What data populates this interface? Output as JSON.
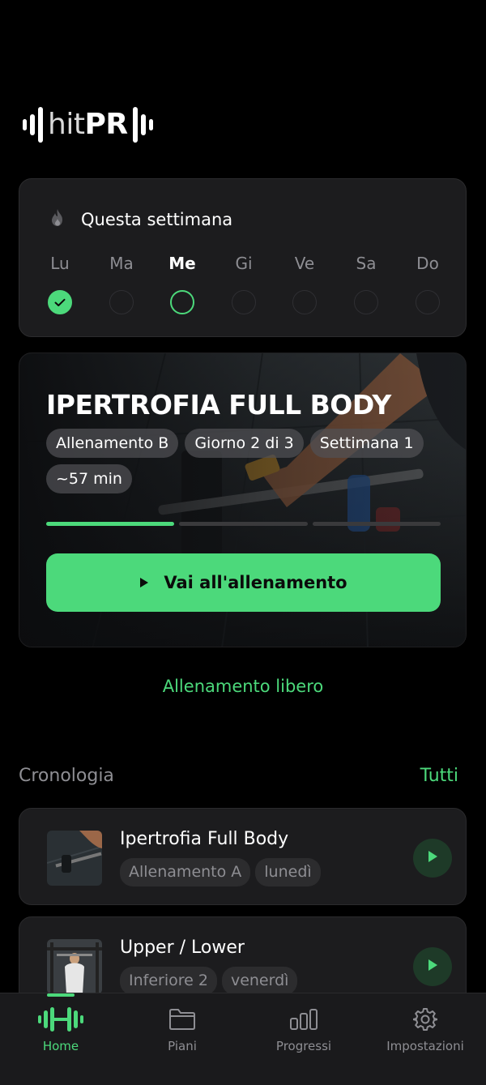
{
  "app": {
    "logo_thin": "hit",
    "logo_bold": "PR"
  },
  "week": {
    "title": "Questa settimana",
    "days": [
      {
        "label": "Lu",
        "state": "done"
      },
      {
        "label": "Ma",
        "state": "empty"
      },
      {
        "label": "Me",
        "state": "today"
      },
      {
        "label": "Gi",
        "state": "empty"
      },
      {
        "label": "Ve",
        "state": "empty"
      },
      {
        "label": "Sa",
        "state": "empty"
      },
      {
        "label": "Do",
        "state": "empty"
      }
    ]
  },
  "workout": {
    "title": "IPERTROFIA FULL BODY",
    "chips": [
      "Allenamento B",
      "Giorno 2 di 3",
      "Settimana 1",
      "~57 min"
    ],
    "progress_done": 1,
    "progress_total": 3,
    "button_label": "Vai all'allenamento"
  },
  "free_workout_label": "Allenamento libero",
  "history": {
    "title": "Cronologia",
    "all_label": "Tutti",
    "items": [
      {
        "name": "Ipertrofia Full Body",
        "tags": [
          "Allenamento A",
          "lunedì"
        ]
      },
      {
        "name": "Upper / Lower",
        "tags": [
          "Inferiore 2",
          "venerdì"
        ]
      }
    ]
  },
  "nav": {
    "items": [
      {
        "label": "Home",
        "icon": "dumbbell-icon",
        "active": true
      },
      {
        "label": "Piani",
        "icon": "folder-icon",
        "active": false
      },
      {
        "label": "Progressi",
        "icon": "bar-chart-icon",
        "active": false
      },
      {
        "label": "Impostazioni",
        "icon": "gear-icon",
        "active": false
      }
    ]
  },
  "colors": {
    "accent": "#4cd97b",
    "card": "#1c1c1e",
    "background": "#000000"
  }
}
